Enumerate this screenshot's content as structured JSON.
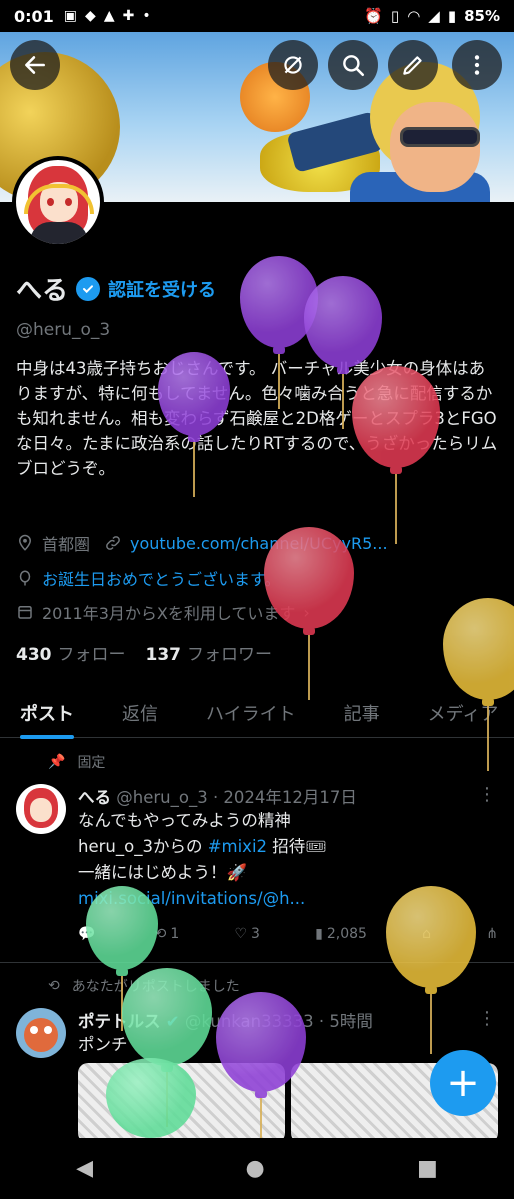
{
  "status_bar": {
    "time": "0:01",
    "battery": "85%",
    "left_icons": [
      "twitch-icon",
      "game-icon",
      "aeon-icon",
      "controller-icon",
      "dot-icon"
    ],
    "right_icons": [
      "alarm-icon",
      "vibrate-icon",
      "wifi-icon",
      "signal-icon",
      "battery-icon"
    ]
  },
  "header": {
    "buttons": [
      "back-button",
      "grok-button",
      "search-button",
      "edit-button",
      "more-button"
    ]
  },
  "profile": {
    "name": "へる",
    "verify_label": "認証を受ける",
    "handle": "@heru_o_3",
    "bio": "中身は43歳子持ちおじさんです。 バーチャル美少女の身体はありますが、特に何もしてません。色々噛み合うと急に配信するかも知れません。相も変わらず石鹸屋と2D格ゲーとスプラ3とFGOな日々。たまに政治系の話したりRTするので、うざかったらリムブロどうぞ。",
    "location": "首都圏",
    "website": "youtube.com/channel/UCyyR5...",
    "birthday": "お誕生日おめでとうございます。",
    "joined": "2011年3月からXを利用しています",
    "following_count": "430",
    "following_label": "フォロー",
    "followers_count": "137",
    "followers_label": "フォロワー"
  },
  "tabs": [
    "ポスト",
    "返信",
    "ハイライト",
    "記事",
    "メディア"
  ],
  "pinned_label": "固定",
  "post1": {
    "name": "へる",
    "handle_date": "@heru_o_3 · 2024年12月17日",
    "line1": "なんでもやってみようの精神",
    "line2_prefix": "heru_o_3からの",
    "line2_tag": "#mixi2",
    "line2_suffix": "招待🎟",
    "line3": "一緒にはじめよう！🚀",
    "line4": "mixi.social/invitations/@h...",
    "replies": "",
    "reposts": "1",
    "likes": "3",
    "views": "2,085"
  },
  "repost_label": "あなたがリポストしました",
  "post2": {
    "name": "ポテトルス",
    "handle_time": "@kunkan33333 · 5時間",
    "text": "ポンチ"
  },
  "fab_label": "+",
  "nav": {
    "back": "◀",
    "home": "●",
    "recent": "■"
  },
  "colors": {
    "accent": "#1d9bf0",
    "balloon_purple": "#8e3fd6",
    "balloon_red": "#e03a52",
    "balloon_yellow": "#e7bd3a",
    "balloon_green": "#5fdc98"
  }
}
